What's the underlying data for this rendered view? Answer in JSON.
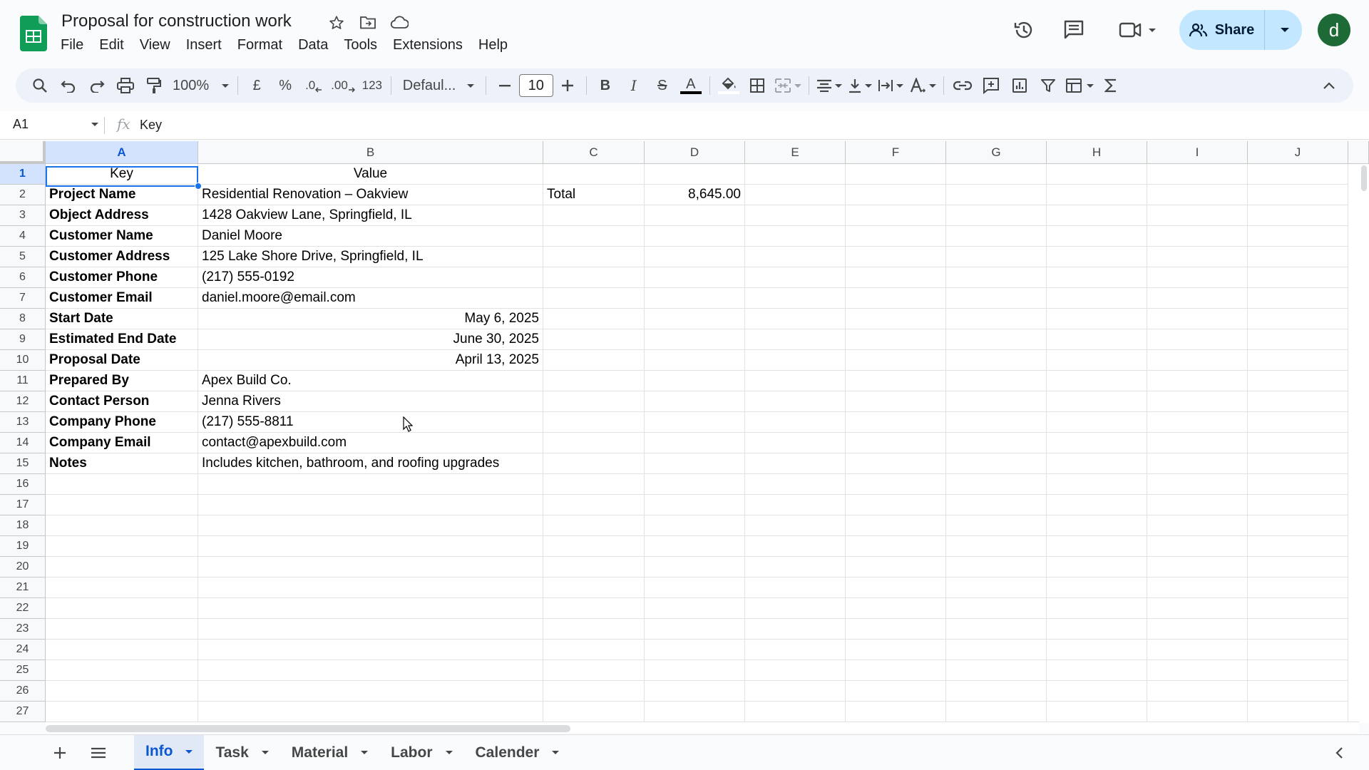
{
  "doc": {
    "title": "Proposal for construction work"
  },
  "menu": [
    "File",
    "Edit",
    "View",
    "Insert",
    "Format",
    "Data",
    "Tools",
    "Extensions",
    "Help"
  ],
  "header": {
    "share_label": "Share",
    "avatar_letter": "d"
  },
  "toolbar": {
    "zoom": "100%",
    "currency": "£",
    "percent": "%",
    "dec_minus": ".0",
    "dec_plus": ".00",
    "number_format": "123",
    "font": "Defaul...",
    "font_size": "10",
    "bold": "B",
    "italic": "I",
    "strike": "S",
    "text_color": "A"
  },
  "formula": {
    "cell_ref": "A1",
    "fx": "fx",
    "value": "Key"
  },
  "columns": [
    "A",
    "B",
    "C",
    "D",
    "E",
    "F",
    "G",
    "H",
    "I",
    "J"
  ],
  "rows": [
    "1",
    "2",
    "3",
    "4",
    "5",
    "6",
    "7",
    "8",
    "9",
    "10",
    "11",
    "12",
    "13",
    "14",
    "15",
    "16",
    "17",
    "18",
    "19",
    "20",
    "21",
    "22",
    "23",
    "24",
    "25",
    "26",
    "27"
  ],
  "cells": {
    "header_key": "Key",
    "header_value": "Value",
    "total_label": "Total",
    "total_value": "8,645.00",
    "items": [
      {
        "key": "Project Name",
        "value": "Residential Renovation – Oakview",
        "align": "left"
      },
      {
        "key": "Object Address",
        "value": "1428 Oakview Lane, Springfield, IL",
        "align": "left"
      },
      {
        "key": "Customer Name",
        "value": "Daniel Moore",
        "align": "left"
      },
      {
        "key": "Customer Address",
        "value": "125 Lake Shore Drive, Springfield, IL",
        "align": "left"
      },
      {
        "key": "Customer Phone",
        "value": "(217) 555-0192",
        "align": "left"
      },
      {
        "key": "Customer Email",
        "value": "daniel.moore@email.com",
        "align": "left"
      },
      {
        "key": "Start Date",
        "value": "May 6, 2025",
        "align": "right"
      },
      {
        "key": "Estimated End Date",
        "value": "June 30, 2025",
        "align": "right"
      },
      {
        "key": "Proposal Date",
        "value": "April 13, 2025",
        "align": "right"
      },
      {
        "key": "Prepared By",
        "value": "Apex Build Co.",
        "align": "left"
      },
      {
        "key": "Contact Person",
        "value": "Jenna Rivers",
        "align": "left"
      },
      {
        "key": "Company Phone",
        "value": "(217) 555-8811",
        "align": "left"
      },
      {
        "key": "Company Email",
        "value": "contact@apexbuild.com",
        "align": "left"
      },
      {
        "key": "Notes",
        "value": "Includes kitchen, bathroom, and roofing upgrades",
        "align": "left"
      }
    ]
  },
  "sheets": [
    {
      "name": "Info",
      "active": true
    },
    {
      "name": "Task",
      "active": false
    },
    {
      "name": "Material",
      "active": false
    },
    {
      "name": "Labor",
      "active": false
    },
    {
      "name": "Calender",
      "active": false
    }
  ],
  "colors": {
    "accent": "#0b57d0",
    "share_bg": "#c2e7ff",
    "avatar": "#1e6a37",
    "sheets_green": "#0f9d58"
  }
}
